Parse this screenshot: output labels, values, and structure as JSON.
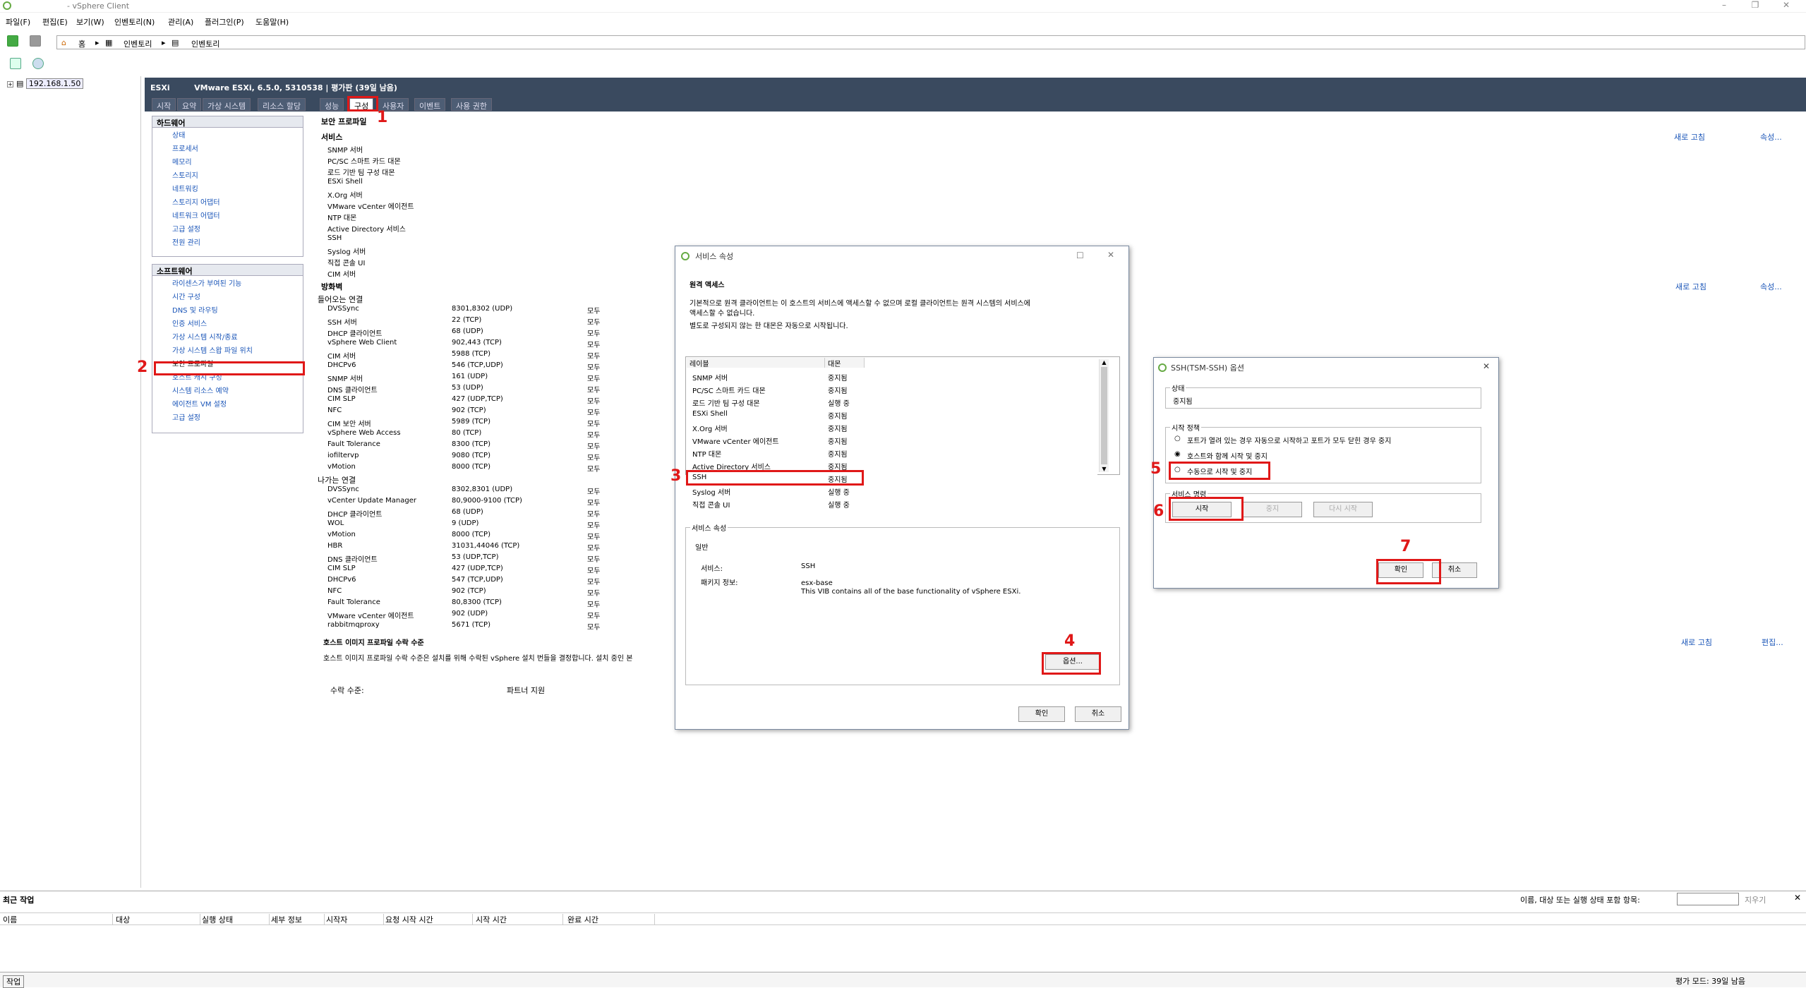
{
  "window": {
    "title": "- vSphere Client"
  },
  "menu": [
    "파일(F)",
    "편집(E)",
    "보기(W)",
    "인벤토리(N)",
    "관리(A)",
    "플러그인(P)",
    "도움말(H)"
  ],
  "nav": {
    "home": "홈",
    "crumb1": "인벤토리",
    "crumb2": "인벤토리"
  },
  "tree": {
    "host": "192.168.1.50"
  },
  "host": {
    "header": "ESXi         VMware ESXi, 6.5.0, 5310538 | 평가판 (39일 남음)"
  },
  "tabs": [
    "시작",
    "요약",
    "가상 시스템",
    "리소스 할당",
    "성능",
    "구성",
    "사용자",
    "이벤트",
    "사용 권한"
  ],
  "hardware": {
    "title": "하드웨어",
    "items": [
      "상태",
      "프로세서",
      "메모리",
      "스토리지",
      "네트워킹",
      "스토리지 어댑터",
      "네트워크 어댑터",
      "고급 설정",
      "전원 관리"
    ]
  },
  "software": {
    "title": "소프트웨어",
    "items": [
      "라이센스가 부여된 기능",
      "시간 구성",
      "DNS 및 라우팅",
      "인증 서비스",
      "가상 시스템 시작/종료",
      "가상 시스템 스왑 파일 위치",
      "보안 프로파일",
      "호스트 캐시 구성",
      "시스템 리소스 예약",
      "에이전트 VM 설정",
      "고급 설정"
    ]
  },
  "profile": {
    "title": "보안 프로파일",
    "services_title": "서비스",
    "refresh": "새로 고침",
    "properties": "속성...",
    "refresh2": "새로 고침",
    "properties2": "속성...",
    "refresh3": "새로 고침",
    "edit3": "편집...",
    "services": [
      "SNMP 서버",
      "PC/SC 스마트 카드 대몬",
      "로드 기반 팀 구성 대몬",
      "ESXi Shell",
      "X.Org 서버",
      "VMware vCenter 에이전트",
      "NTP 대몬",
      "Active Directory 서비스",
      "SSH",
      "Syslog 서버",
      "직접 콘솔 UI",
      "CIM 서버"
    ],
    "firewall_title": "방화벽",
    "incoming_title": "들어오는 연결",
    "outgoing_title": "나가는 연결",
    "incoming": [
      [
        "DVSSync",
        "8301,8302 (UDP)",
        "모두"
      ],
      [
        "SSH 서버",
        "22 (TCP)",
        "모두"
      ],
      [
        "DHCP 클라이언트",
        "68 (UDP)",
        "모두"
      ],
      [
        "vSphere Web Client",
        "902,443 (TCP)",
        "모두"
      ],
      [
        "CIM 서버",
        "5988 (TCP)",
        "모두"
      ],
      [
        "DHCPv6",
        "546 (TCP,UDP)",
        "모두"
      ],
      [
        "SNMP 서버",
        "161 (UDP)",
        "모두"
      ],
      [
        "DNS 클라이언트",
        "53 (UDP)",
        "모두"
      ],
      [
        "CIM SLP",
        "427 (UDP,TCP)",
        "모두"
      ],
      [
        "NFC",
        "902 (TCP)",
        "모두"
      ],
      [
        "CIM 보안 서버",
        "5989 (TCP)",
        "모두"
      ],
      [
        "vSphere Web Access",
        "80 (TCP)",
        "모두"
      ],
      [
        "Fault Tolerance",
        "8300 (TCP)",
        "모두"
      ],
      [
        "iofiltervp",
        "9080 (TCP)",
        "모두"
      ],
      [
        "vMotion",
        "8000 (TCP)",
        "모두"
      ]
    ],
    "outgoing": [
      [
        "DVSSync",
        "8302,8301 (UDP)",
        "모두"
      ],
      [
        "vCenter Update Manager",
        "80,9000-9100 (TCP)",
        "모두"
      ],
      [
        "DHCP 클라이언트",
        "68 (UDP)",
        "모두"
      ],
      [
        "WOL",
        "9 (UDP)",
        "모두"
      ],
      [
        "vMotion",
        "8000 (TCP)",
        "모두"
      ],
      [
        "HBR",
        "31031,44046 (TCP)",
        "모두"
      ],
      [
        "DNS 클라이언트",
        "53 (UDP,TCP)",
        "모두"
      ],
      [
        "CIM SLP",
        "427 (UDP,TCP)",
        "모두"
      ],
      [
        "DHCPv6",
        "547 (TCP,UDP)",
        "모두"
      ],
      [
        "NFC",
        "902 (TCP)",
        "모두"
      ],
      [
        "Fault Tolerance",
        "80,8300 (TCP)",
        "모두"
      ],
      [
        "VMware vCenter 에이전트",
        "902 (UDP)",
        "모두"
      ],
      [
        "rabbitmqproxy",
        "5671 (TCP)",
        "모두"
      ]
    ],
    "img_title": "호스트 이미지 프로파일 수락 수준",
    "img_desc": "호스트 이미지 프로파일 수락 수준은 설치를 위해 수락된 vSphere 설치 번들을 결정합니다. 설치 중인 본",
    "accept_label": "수락 수준:",
    "accept_value": "파트너 지원"
  },
  "svc_dialog": {
    "title": "서비스 속성",
    "remote_title": "원격 액세스",
    "desc1": "기본적으로 원격 클라이언트는 이 호스트의 서비스에 액세스할 수 없으며 로컬 클라이언트는 원격 시스템의 서비스에",
    "desc2": "액세스할 수 없습니다.",
    "desc3": "별도로 구성되지 않는 한 대몬은 자동으로 시작됩니다.",
    "col_label": "레이블",
    "col_daemon": "대몬",
    "rows": [
      [
        "SNMP 서버",
        "중지됨"
      ],
      [
        "PC/SC 스마트 카드 대몬",
        "중지됨"
      ],
      [
        "로드 기반 팀 구성 대몬",
        "실행 중"
      ],
      [
        "ESXi Shell",
        "중지됨"
      ],
      [
        "X.Org 서버",
        "중지됨"
      ],
      [
        "VMware vCenter 에이전트",
        "중지됨"
      ],
      [
        "NTP 대몬",
        "중지됨"
      ],
      [
        "Active Directory 서비스",
        "중지됨"
      ],
      [
        "SSH",
        "중지됨"
      ],
      [
        "Syslog 서버",
        "실행 중"
      ],
      [
        "직접 콘솔 UI",
        "실행 중"
      ]
    ],
    "props_title": "서비스 속성",
    "general": "일반",
    "svc_label": "서비스:",
    "svc_value": "SSH",
    "pkg_label": "패키지 정보:",
    "pkg_value": "esx-base",
    "pkg_desc": "This VIB contains all of the base functionality of vSphere ESXi.",
    "options": "옵션...",
    "ok": "확인",
    "cancel": "취소"
  },
  "ssh_dialog": {
    "title": "SSH(TSM-SSH) 옵션",
    "status_title": "상태",
    "status_value": "중지됨",
    "policy_title": "시작 정책",
    "policy1": "포트가 열려 있는 경우 자동으로 시작하고 포트가 모두 닫힌 경우 중지",
    "policy2": "호스트와 함께 시작 및 중지",
    "policy3": "수동으로 시작 및 중지",
    "cmd_title": "서비스 명령",
    "start": "시작",
    "stop": "중지",
    "restart": "다시 시작",
    "ok": "확인",
    "cancel": "취소"
  },
  "steps": [
    "1",
    "2",
    "3",
    "4",
    "5",
    "6",
    "7"
  ],
  "bottom": {
    "title": "최근 작업",
    "filter": "이름, 대상 또는 실행 상태 포함 항목:",
    "clear": "지우기",
    "cols": [
      "이름",
      "대상",
      "실행 상태",
      "세부 정보",
      "시작자",
      "요청 시작 시간",
      "시작 시간",
      "완료 시간"
    ],
    "task": "작업",
    "status": "평가 모드: 39일 남음"
  }
}
